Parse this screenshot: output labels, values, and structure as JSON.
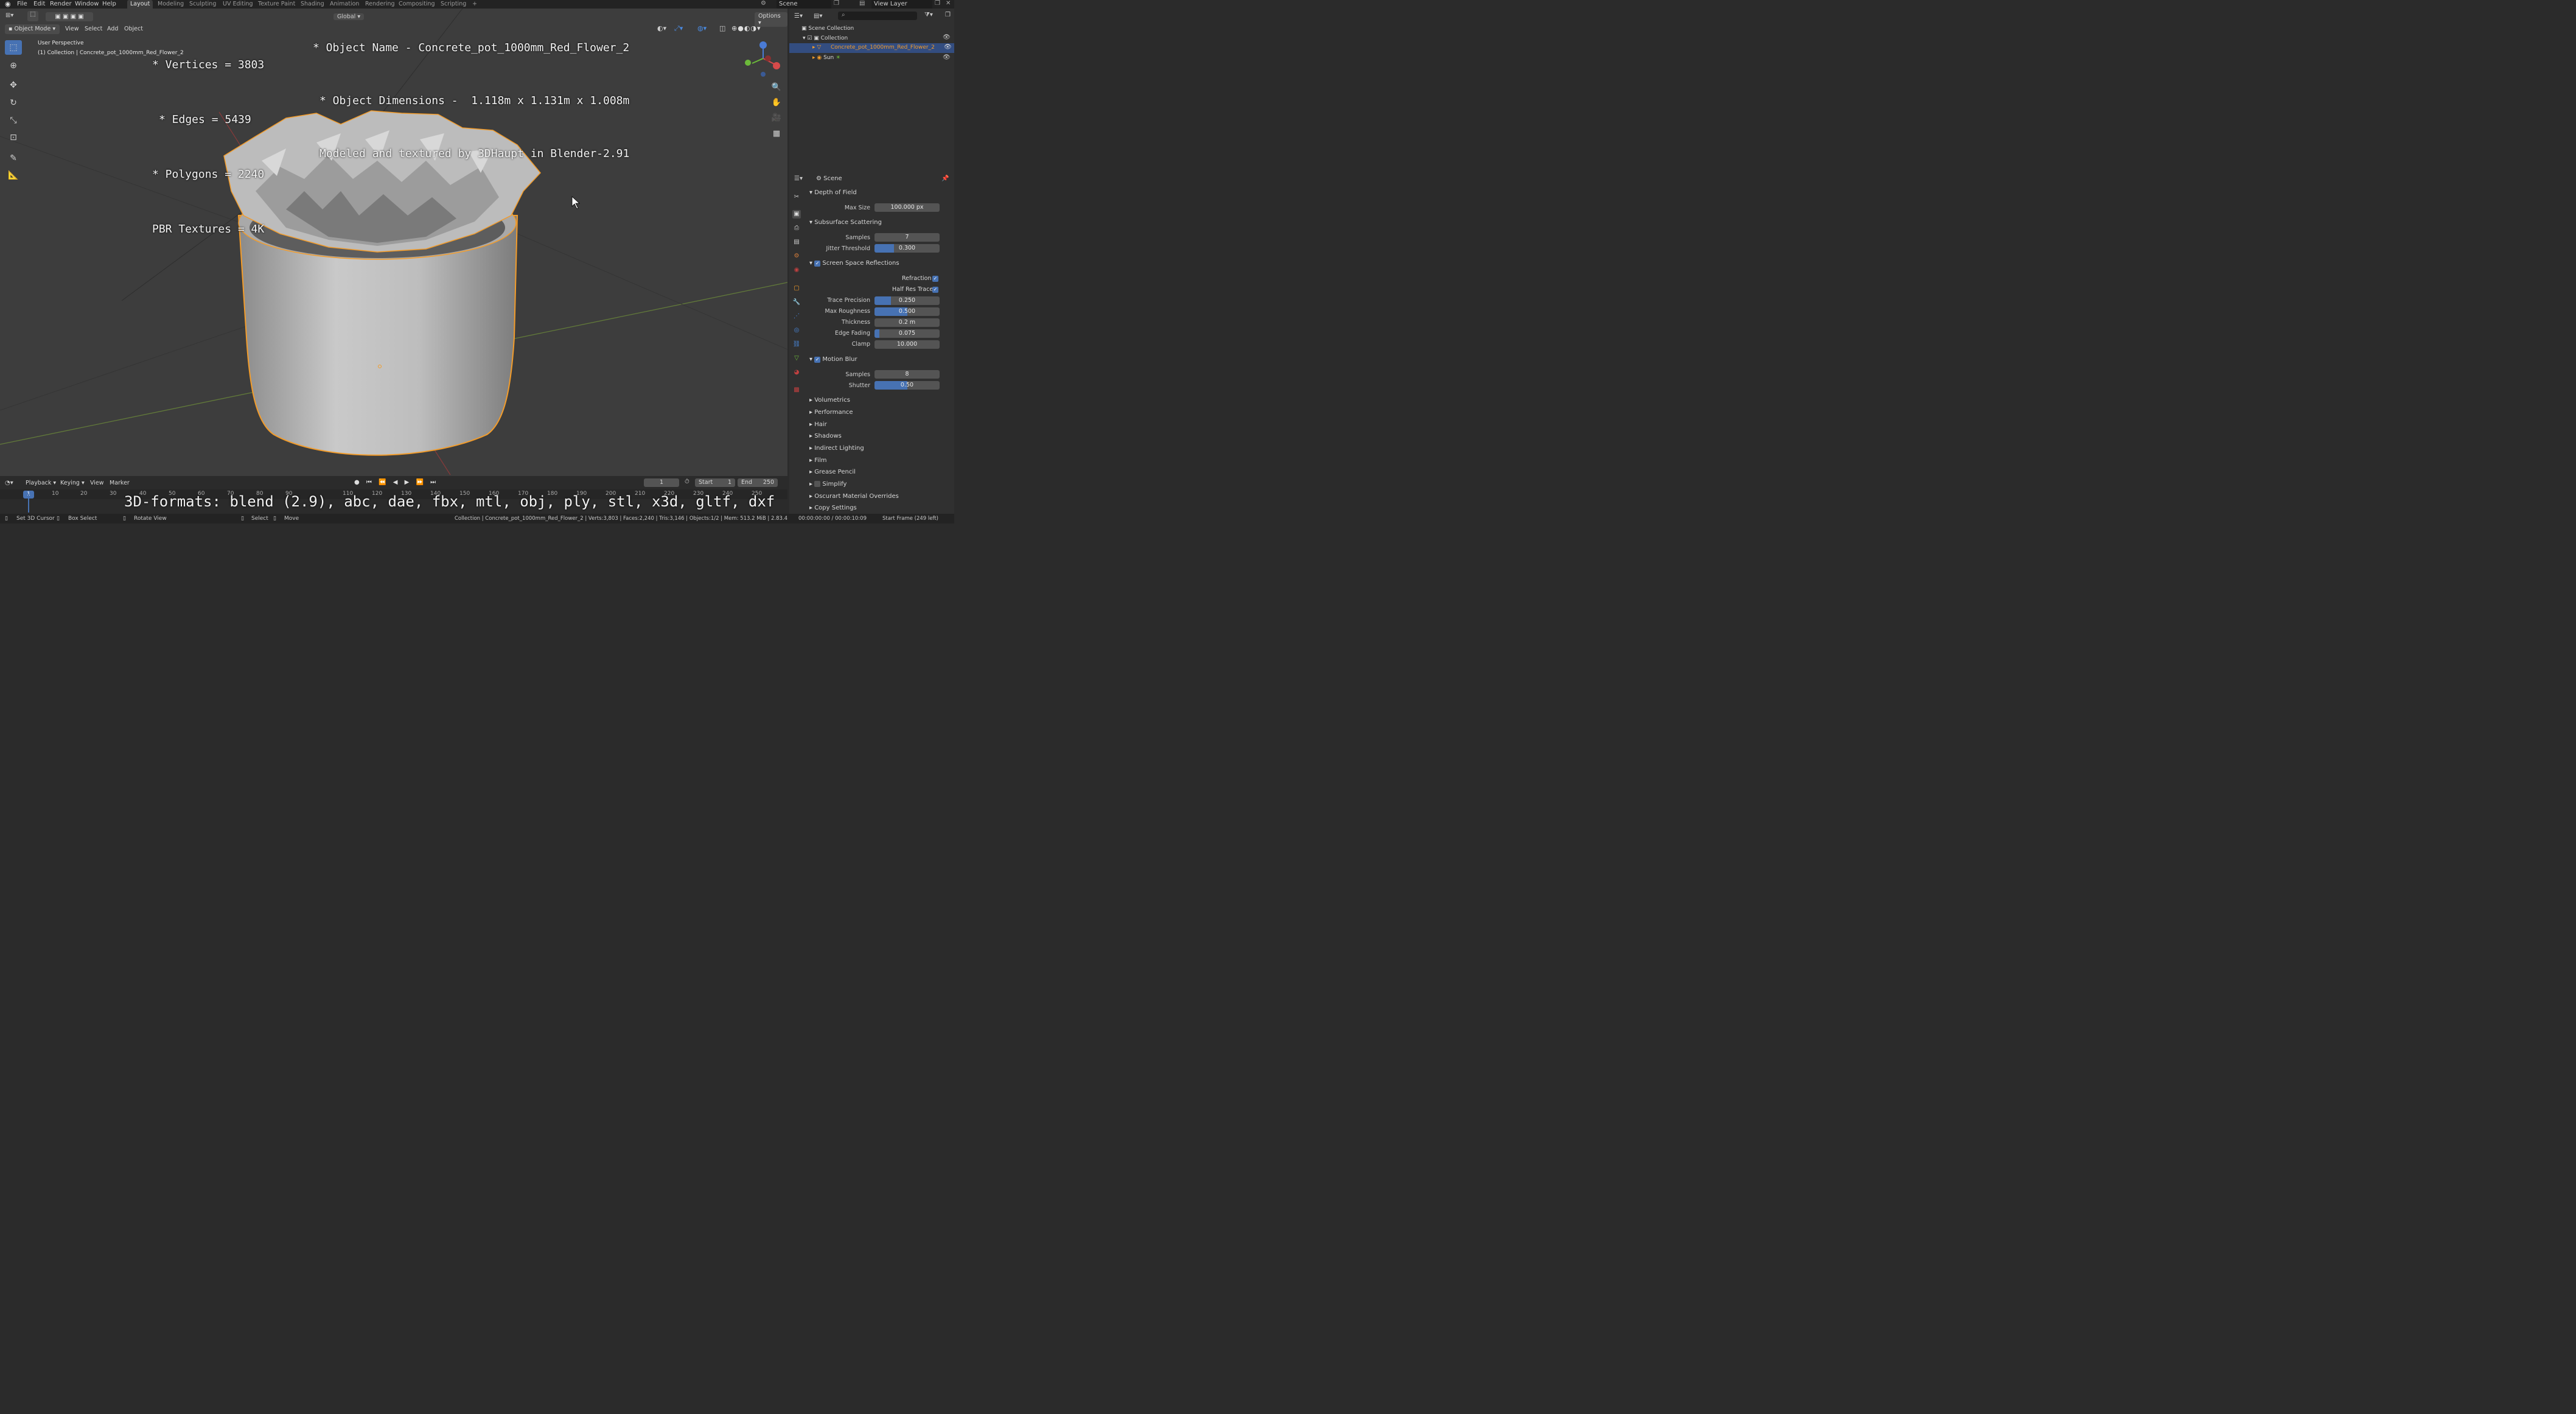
{
  "menu": {
    "file": "File",
    "edit": "Edit",
    "render": "Render",
    "window": "Window",
    "help": "Help"
  },
  "workspaces": [
    "Layout",
    "Modeling",
    "Sculpting",
    "UV Editing",
    "Texture Paint",
    "Shading",
    "Animation",
    "Rendering",
    "Compositing",
    "Scripting",
    "+"
  ],
  "top_right": {
    "scene": "Scene",
    "view_layer": "View Layer"
  },
  "viewport": {
    "mode": "Object Mode",
    "menu": [
      "View",
      "Select",
      "Add",
      "Object"
    ],
    "transform": "Global",
    "options": "Options",
    "perspective": "User Perspective",
    "collection_info": "(1) Collection | Concrete_pot_1000mm_Red_Flower_2",
    "overlay_left": [
      "* Vertices = 3803",
      "* Edges = 5439",
      "* Polygons = 2240",
      "PBR Textures = 4K"
    ],
    "overlay_right": [
      "* Object Name - Concrete_pot_1000mm_Red_Flower_2",
      "* Object Dimensions -  1.118m x 1.131m x 1.008m",
      "Modeled and textured by 3DHaupt in Blender-2.91"
    ],
    "formats": "3D-formats: blend (2.9), abc, dae, fbx, mtl, obj, ply, stl, x3d, gltf, dxf"
  },
  "outliner": {
    "root": "Scene Collection",
    "collection": "Collection",
    "object": "Concrete_pot_1000mm_Red_Flower_2",
    "light": "Sun"
  },
  "properties": {
    "scene": "Scene",
    "dof": {
      "title": "Depth of Field",
      "max_size_label": "Max Size",
      "max_size": "100.000 px"
    },
    "sss": {
      "title": "Subsurface Scattering",
      "samples_label": "Samples",
      "samples": "7",
      "jitter_label": "Jitter Threshold",
      "jitter": "0.300",
      "jitter_fill": 0.3
    },
    "ssr": {
      "title": "Screen Space Reflections",
      "refraction": "Refraction",
      "half_res": "Half Res Trace",
      "trace_label": "Trace Precision",
      "trace": "0.250",
      "trace_fill": 0.25,
      "rough_label": "Max Roughness",
      "rough": "0.500",
      "rough_fill": 0.5,
      "thick_label": "Thickness",
      "thick": "0.2 m",
      "edge_label": "Edge Fading",
      "edge": "0.075",
      "edge_fill": 0.075,
      "clamp_label": "Clamp",
      "clamp": "10.000"
    },
    "mb": {
      "title": "Motion Blur",
      "samples_label": "Samples",
      "samples": "8",
      "shutter_label": "Shutter",
      "shutter": "0.50",
      "shutter_fill": 0.5
    },
    "collapsed": [
      "Volumetrics",
      "Performance",
      "Hair",
      "Shadows",
      "Indirect Lighting",
      "Film",
      "Grease Pencil",
      "Simplify",
      "Oscurart Material Overrides",
      "Copy Settings"
    ]
  },
  "timeline": {
    "menu": [
      "Playback",
      "Keying",
      "View",
      "Marker"
    ],
    "frame": "1",
    "start_label": "Start",
    "start": "1",
    "end_label": "End",
    "end": "250",
    "current": "1",
    "ticks": [
      "10",
      "20",
      "30",
      "40",
      "50",
      "60",
      "70",
      "80",
      "90",
      "110",
      "120",
      "130",
      "140",
      "150",
      "160",
      "170",
      "180",
      "190",
      "200",
      "210",
      "220",
      "230",
      "240",
      "250"
    ]
  },
  "status": {
    "set_cursor": "Set 3D Cursor",
    "box_select": "Box Select",
    "rotate": "Rotate View",
    "select": "Select",
    "move": "Move",
    "info": "Collection | Concrete_pot_1000mm_Red_Flower_2 | Verts:3,803 | Faces:2,240 | Tris:3,146 | Objects:1/2 | Mem: 513.2 MiB | 2.83.4",
    "time": "00:00:00:00 / 00:00:10:09",
    "start_frame": "Start Frame (249 left)"
  },
  "colors": {
    "accent": "#4772b3",
    "selection": "#f39c2a",
    "bg_viewport": "#3d3d3d"
  }
}
